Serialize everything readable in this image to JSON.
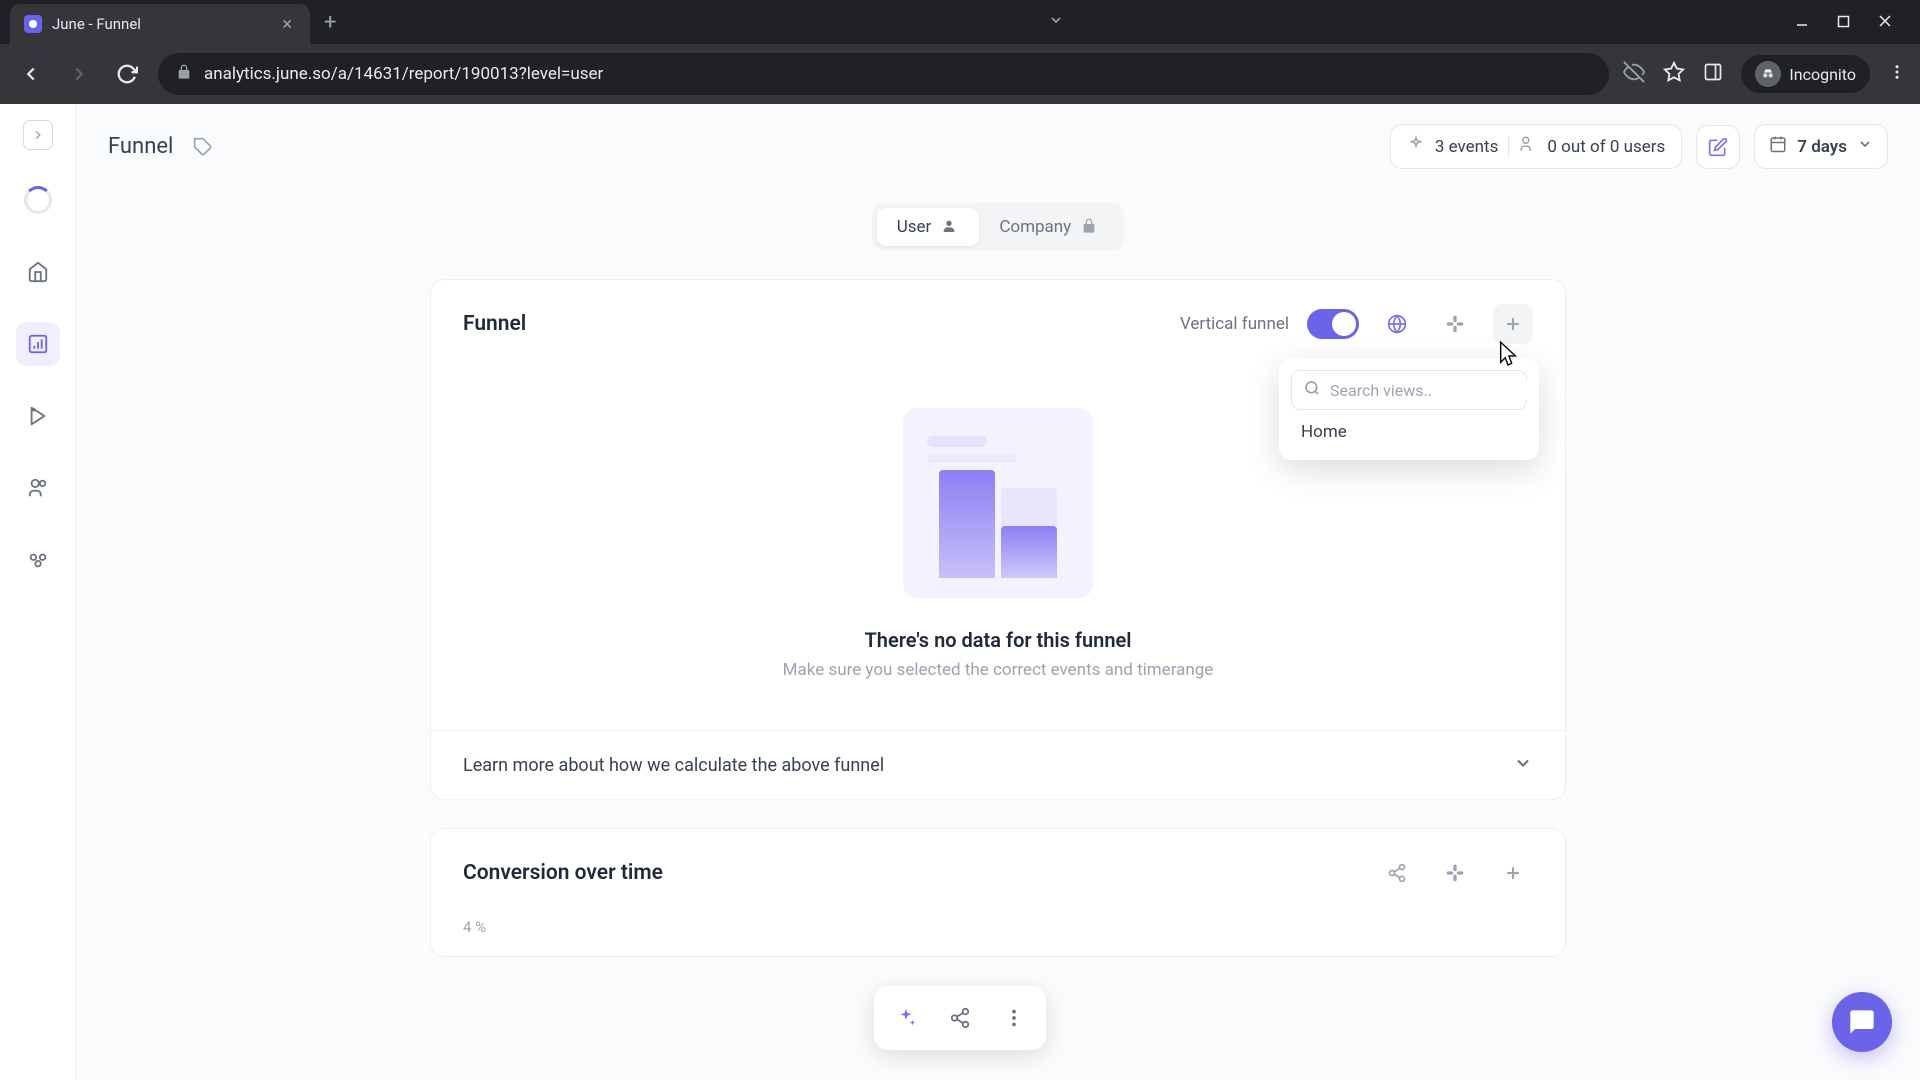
{
  "browser": {
    "tab_title": "June - Funnel",
    "url": "analytics.june.so/a/14631/report/190013?level=user",
    "incognito_label": "Incognito"
  },
  "header": {
    "title": "Funnel",
    "events_label": "3 events",
    "users_label": "0 out of 0 users",
    "date_label": "7 days"
  },
  "segmented": {
    "user_label": "User",
    "company_label": "Company"
  },
  "funnel_card": {
    "title": "Funnel",
    "toggle_label": "Vertical funnel",
    "empty_title": "There's no data for this funnel",
    "empty_subtitle": "Make sure you selected the correct events and timerange",
    "learn_more": "Learn more about how we calculate the above funnel"
  },
  "popup": {
    "search_placeholder": "Search views..",
    "item_home": "Home"
  },
  "conversion_card": {
    "title": "Conversion over time",
    "y_axis_label": "4 %"
  }
}
